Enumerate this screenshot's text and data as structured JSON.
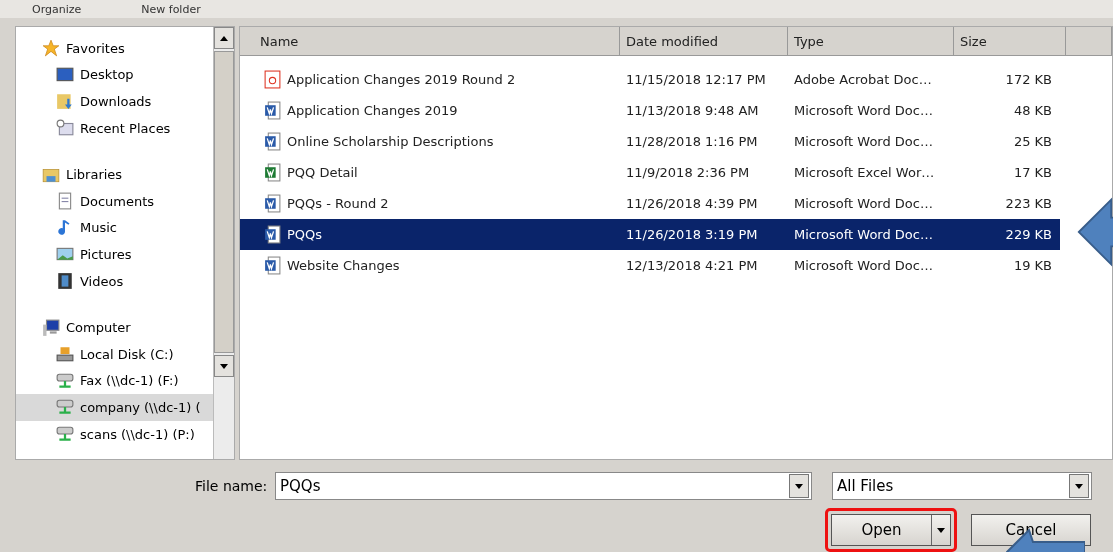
{
  "toolbar": {
    "items": [
      "Organize",
      "New folder"
    ]
  },
  "sidebar": {
    "groups": [
      {
        "label": "Favorites",
        "kind": "favorites",
        "children": [
          {
            "label": "Desktop",
            "kind": "desktop",
            "selected": false
          },
          {
            "label": "Downloads",
            "kind": "downloads",
            "selected": false
          },
          {
            "label": "Recent Places",
            "kind": "recent",
            "selected": false
          }
        ]
      },
      {
        "label": "Libraries",
        "kind": "libraries",
        "children": [
          {
            "label": "Documents",
            "kind": "documents",
            "selected": false
          },
          {
            "label": "Music",
            "kind": "music",
            "selected": false
          },
          {
            "label": "Pictures",
            "kind": "pictures",
            "selected": false
          },
          {
            "label": "Videos",
            "kind": "videos",
            "selected": false
          }
        ]
      },
      {
        "label": "Computer",
        "kind": "computer",
        "children": [
          {
            "label": "Local Disk (C:)",
            "kind": "disk",
            "selected": false
          },
          {
            "label": "Fax (\\\\dc-1) (F:)",
            "kind": "network",
            "selected": false
          },
          {
            "label": "company (\\\\dc-1) (",
            "kind": "network",
            "selected": true
          },
          {
            "label": "scans (\\\\dc-1) (P:)",
            "kind": "network",
            "selected": false
          }
        ]
      }
    ]
  },
  "table": {
    "columns": [
      "Name",
      "Date modified",
      "Type",
      "Size"
    ],
    "rows": [
      {
        "name": "Application Changes 2019 Round 2",
        "date": "11/15/2018 12:17 PM",
        "type": "Adobe Acrobat Doc…",
        "size": "172 KB",
        "kind": "pdf",
        "selected": false
      },
      {
        "name": "Application Changes 2019",
        "date": "11/13/2018 9:48 AM",
        "type": "Microsoft Word Doc…",
        "size": "48 KB",
        "kind": "word",
        "selected": false
      },
      {
        "name": "Online Scholarship Descriptions",
        "date": "11/28/2018 1:16 PM",
        "type": "Microsoft Word Doc…",
        "size": "25 KB",
        "kind": "word",
        "selected": false
      },
      {
        "name": "PQQ Detail",
        "date": "11/9/2018 2:36 PM",
        "type": "Microsoft Excel Wor…",
        "size": "17 KB",
        "kind": "excel",
        "selected": false
      },
      {
        "name": "PQQs - Round 2",
        "date": "11/26/2018 4:39 PM",
        "type": "Microsoft Word Doc…",
        "size": "223 KB",
        "kind": "word",
        "selected": false
      },
      {
        "name": "PQQs",
        "date": "11/26/2018 3:19 PM",
        "type": "Microsoft Word Doc…",
        "size": "229 KB",
        "kind": "word",
        "selected": true
      },
      {
        "name": "Website Changes",
        "date": "12/13/2018 4:21 PM",
        "type": "Microsoft Word Doc…",
        "size": "19 KB",
        "kind": "word",
        "selected": false
      }
    ]
  },
  "footer": {
    "file_name_label": "File name:",
    "file_name_value": "PQQs",
    "file_type": "All Files",
    "open_button": "Open",
    "cancel_button": "Cancel"
  }
}
